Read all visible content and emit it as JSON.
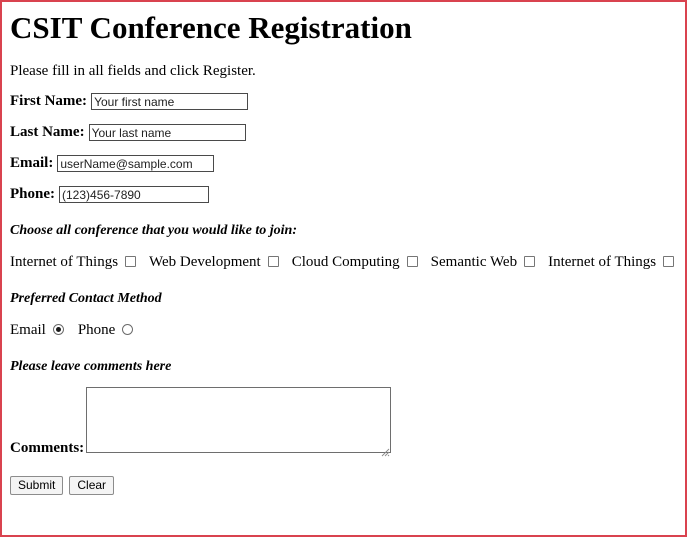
{
  "page": {
    "title": "CSIT Conference Registration",
    "intro": "Please fill in all fields and click Register.",
    "border_color": "#d9434f"
  },
  "fields": [
    {
      "label": "First Name:",
      "value": "Your first name",
      "placeholder": "Your first name",
      "name": "first-name"
    },
    {
      "label": "Last Name:",
      "value": "Your last name",
      "placeholder": "Your last name",
      "name": "last-name"
    },
    {
      "label": "Email:",
      "value": "userName@sample.com",
      "placeholder": "userName@sample.com",
      "name": "email"
    },
    {
      "label": "Phone:",
      "value": "(123)456-7890",
      "placeholder": "(123)456-7890",
      "name": "phone"
    }
  ],
  "conferences": {
    "heading": "Choose all conference that you would like to join:",
    "options": [
      {
        "label": "Internet of Things",
        "checked": false
      },
      {
        "label": "Web Development",
        "checked": false
      },
      {
        "label": "Cloud Computing",
        "checked": false
      },
      {
        "label": "Semantic Web",
        "checked": false
      },
      {
        "label": "Internet of Things",
        "checked": false
      }
    ]
  },
  "contact": {
    "heading": "Preferred Contact Method",
    "options": [
      {
        "label": "Email",
        "checked": true
      },
      {
        "label": "Phone",
        "checked": false
      }
    ]
  },
  "comments": {
    "heading": "Please leave comments here",
    "label": "Comments:",
    "value": "",
    "placeholder": ""
  },
  "buttons": [
    {
      "label": "Submit",
      "name": "submit-button"
    },
    {
      "label": "Clear",
      "name": "clear-button"
    }
  ]
}
